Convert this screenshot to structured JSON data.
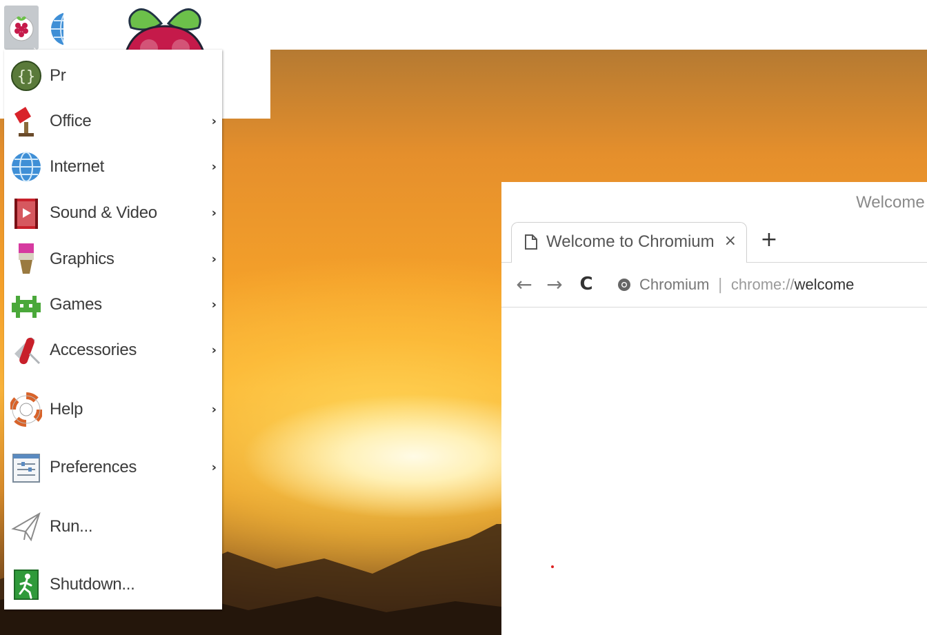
{
  "desktop": {
    "menu_button_icon": "raspberry-pi-icon",
    "browser_launcher_icon": "globe-icon",
    "logo_icon": "raspberry-pi-logo"
  },
  "menu": {
    "items": [
      {
        "label": "Pr",
        "icon": "programming-icon",
        "has_submenu": false
      },
      {
        "label": "Office",
        "icon": "office-icon",
        "has_submenu": true
      },
      {
        "label": "Internet",
        "icon": "globe-icon",
        "has_submenu": true
      },
      {
        "label": "Sound & Video",
        "icon": "sound-video-icon",
        "has_submenu": true
      },
      {
        "label": "Graphics",
        "icon": "paintbrush-icon",
        "has_submenu": true
      },
      {
        "label": "Games",
        "icon": "space-invader-icon",
        "has_submenu": true
      },
      {
        "label": "Accessories",
        "icon": "pocket-knife-icon",
        "has_submenu": true
      },
      {
        "label": "Help",
        "icon": "lifebuoy-icon",
        "has_submenu": true
      },
      {
        "label": "Preferences",
        "icon": "preferences-icon",
        "has_submenu": true
      },
      {
        "label": "Run...",
        "icon": "paper-plane-icon",
        "has_submenu": false
      },
      {
        "label": "Shutdown...",
        "icon": "exit-icon",
        "has_submenu": false
      }
    ],
    "submenu_arrow": "›"
  },
  "browser": {
    "window_title": "Welcome t",
    "tab": {
      "title": "Welcome to Chromium",
      "close": "×",
      "icon": "page-icon"
    },
    "new_tab": "+",
    "nav": {
      "back": "←",
      "forward": "→",
      "reload": "C"
    },
    "omnibox": {
      "site_name": "Chromium",
      "separator": "|",
      "url_scheme": "chrome://",
      "url_host": "welcome"
    }
  },
  "colors": {
    "menu_bg": "#ffffff",
    "menu_button_bg": "#c5c9cd",
    "raspberry_red": "#c51a4a",
    "leaf_green": "#6cc04a"
  }
}
